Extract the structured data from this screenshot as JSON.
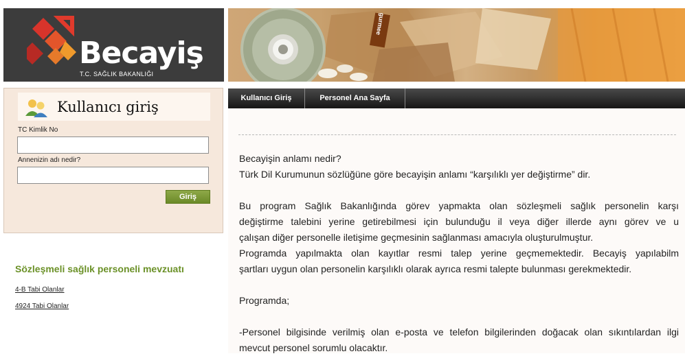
{
  "logo": {
    "brand": "Becayiş",
    "subtitle": "T.C. SAĞLIK BAKANLIĞI"
  },
  "login": {
    "title": "Kullanıcı giriş",
    "tc_label": "TC Kimlik No",
    "tc_value": "",
    "mother_label": "Annenizin adı nedir?",
    "mother_value": "",
    "submit_label": "Giriş"
  },
  "mevzuat": {
    "title": "Sözleşmeli sağlık personeli mevzuatı",
    "links": [
      "4-B Tabi Olanlar",
      "4924 Tabi Olanlar"
    ]
  },
  "banner": {
    "cd_label": "gurmee"
  },
  "nav": {
    "items": [
      "Kullanıcı Giriş",
      "Personel Ana Sayfa"
    ]
  },
  "content": {
    "lines": [
      "Becayişin anlamı nedir?",
      "Türk Dil Kurumunun sözlüğüne göre becayişin anlamı “karşılıklı yer değiştirme” dir.",
      "Bu program Sağlık Bakanlığında görev yapmakta olan sözleşmeli sağlık personelin karşı",
      "değiştirme talebini yerine getirebilmesi için bulunduğu il veya diğer illerde aynı görev ve u",
      "çalışan diğer personelle iletişime geçmesinin sağlanması amacıyla oluşturulmuştur.",
      "Programda yapılmakta olan kayıtlar resmi talep yerine geçmemektedir. Becayiş yapılabilm",
      "şartları uygun olan personelin karşılıklı olarak ayrıca resmi talepte bulunması gerekmektedir.",
      "Programda;",
      "-Personel bilgisinde verilmiş olan e-posta ve telefon bilgilerinden doğacak olan sıkıntılardan ilgi",
      "mevcut personel sorumlu olacaktır."
    ]
  },
  "colors": {
    "logo_bg": "#3c3c3c",
    "login_bg": "#f6e8dc",
    "accent_green": "#6b9128",
    "nav_bg": "#1e1e1e"
  }
}
